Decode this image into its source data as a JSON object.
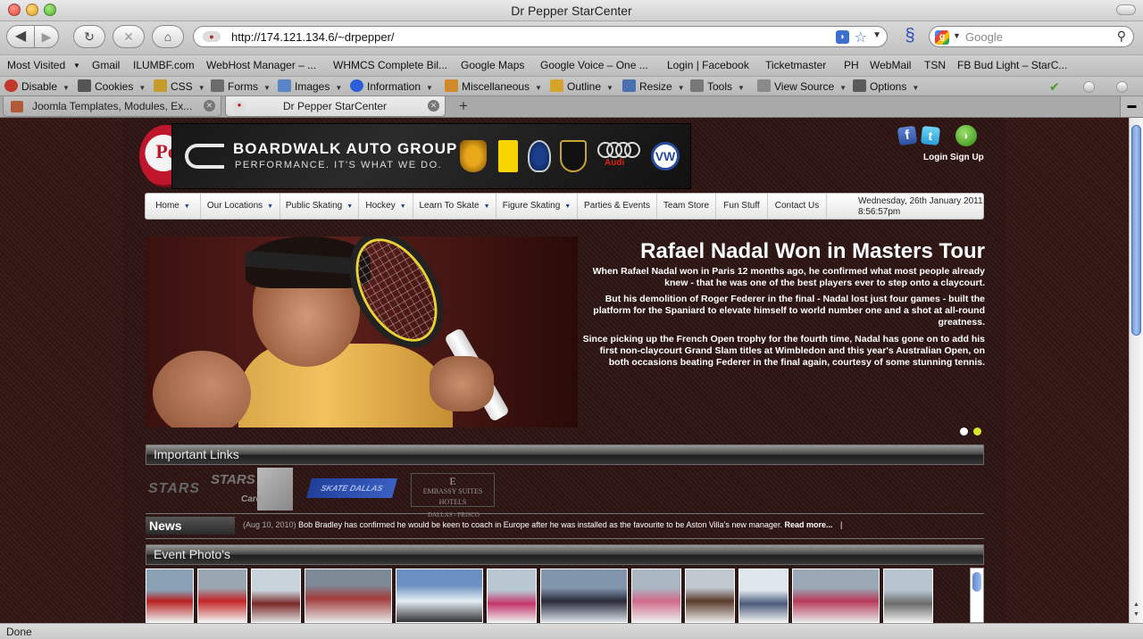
{
  "window": {
    "title": "Dr Pepper StarCenter"
  },
  "nav": {
    "url": "http://174.121.134.6/~drpepper/",
    "search_placeholder": "Google",
    "back_icon": "◀",
    "forward_icon": "▶",
    "reload_icon": "↻",
    "stop_icon": "✕",
    "home_icon": "⌂"
  },
  "bookmarks": [
    "Most Visited",
    "Gmail",
    "ILUMBF.com",
    "WebHost Manager – ...",
    "WHMCS Complete Bil...",
    "Google Maps",
    "Google Voice – One ...",
    "Login | Facebook",
    "Ticketmaster",
    "PH",
    "WebMail",
    "TSN",
    "FB Bud Light – StarC..."
  ],
  "devbar": [
    {
      "label": "Disable",
      "icon": "disable-icon",
      "color": "#c0392b"
    },
    {
      "label": "Cookies",
      "icon": "cookies-icon",
      "color": "#555555"
    },
    {
      "label": "CSS",
      "icon": "css-icon",
      "color": "#c79b2a"
    },
    {
      "label": "Forms",
      "icon": "forms-icon",
      "color": "#6b6b6b"
    },
    {
      "label": "Images",
      "icon": "images-icon",
      "color": "#5b86c5"
    },
    {
      "label": "Information",
      "icon": "information-icon",
      "color": "#2b5fd6"
    },
    {
      "label": "Miscellaneous",
      "icon": "miscellaneous-icon",
      "color": "#d08a2b"
    },
    {
      "label": "Outline",
      "icon": "outline-icon",
      "color": "#d6a42b"
    },
    {
      "label": "Resize",
      "icon": "resize-icon",
      "color": "#4b6fb0"
    },
    {
      "label": "Tools",
      "icon": "tools-icon",
      "color": "#777777"
    },
    {
      "label": "View Source",
      "icon": "view-source-icon",
      "color": "#8a8a8a"
    },
    {
      "label": "Options",
      "icon": "options-icon",
      "color": "#5a5a5a"
    }
  ],
  "tabs": [
    {
      "label": "Joomla Templates, Modules, Ex...",
      "active": false
    },
    {
      "label": "Dr Pepper StarCenter",
      "active": true
    }
  ],
  "status": {
    "text": "Done"
  },
  "site": {
    "logo_text": "Pe",
    "banner": {
      "title": "BOARDWALK AUTO GROUP",
      "tagline": "PERFORMANCE. IT'S WHAT WE DO.",
      "audi_label": "Audi",
      "vw_label": "VW"
    },
    "social": {
      "login": "Login",
      "signup": "Sign Up"
    },
    "menu": [
      {
        "label": "Home",
        "caret": true
      },
      {
        "label": "Our Locations",
        "caret": true
      },
      {
        "label": "Public Skating",
        "caret": true
      },
      {
        "label": "Hockey",
        "caret": true
      },
      {
        "label": "Learn To Skate",
        "caret": true
      },
      {
        "label": "Figure Skating",
        "caret": true
      },
      {
        "label": "Parties & Events",
        "caret": false
      },
      {
        "label": "Team Store",
        "caret": false
      },
      {
        "label": "Fun Stuff",
        "caret": false
      },
      {
        "label": "Contact Us",
        "caret": false
      }
    ],
    "datetime": {
      "date": "Wednesday, 26th January 2011",
      "time": "8:56:57pm"
    },
    "hero": {
      "headline": "Rafael Nadal Won in Masters Tour",
      "paragraphs": [
        "When Rafael Nadal won in Paris 12 months ago, he confirmed what most people already knew - that he was one of the best players ever to step onto a claycourt.",
        "But his demolition of Roger Federer in the final - Nadal lost just four games - built the platform for the Spaniard to elevate himself to world number one and a shot at all-round greatness.",
        "Since picking up the French Open trophy for the fourth time, Nadal has gone on to add his first non-claycourt Grand Slam titles at Wimbledon and this year's Australian Open, on both occasions beating Federer in the final again, courtesy of some stunning tennis."
      ],
      "active_slide": 2,
      "slide_count": 2
    },
    "sections": {
      "links": "Important Links",
      "photos": "Event Photo's"
    },
    "partners": {
      "stars": "STARS",
      "stars_care": "STARS",
      "stars_care_sub": "Care",
      "skate": "SKATE DALLAS",
      "embassy_line1": "EMBASSY SUITES",
      "embassy_line2": "HOTELS",
      "embassy_line3": "DALLAS - FRISCO",
      "embassy_mark": "E"
    },
    "news": {
      "label": "News",
      "date": "(Aug 10, 2010)",
      "text": "Bob Bradley has confirmed he would be keen to coach in Europe after he was installed as the favourite to be Aston Villa's new manager.",
      "more": "Read more...",
      "separator": "|"
    },
    "colors": {
      "accent_blue": "#1f3f9a",
      "slider_active": "#d8e82a",
      "page_bg": "#341a18"
    }
  }
}
